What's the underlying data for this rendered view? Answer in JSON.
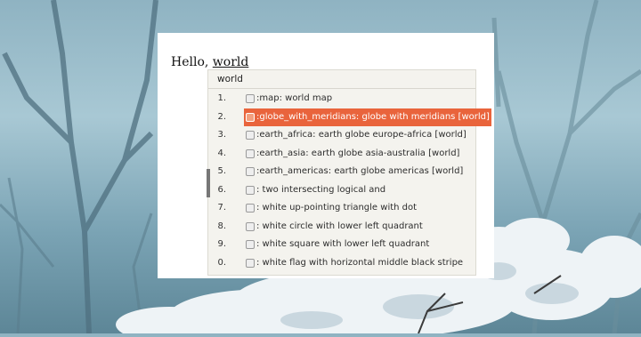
{
  "editor": {
    "greeting": "Hello,",
    "word": "world"
  },
  "popup": {
    "query": "world",
    "items": [
      {
        "num": "1.",
        "icon": "map-icon",
        "label": ":map: world map",
        "selected": false
      },
      {
        "num": "2.",
        "icon": "globe-with-meridians-icon",
        "label": ":globe_with_meridians: globe with meridians [world]",
        "selected": true
      },
      {
        "num": "3.",
        "icon": "earth-africa-icon",
        "label": ":earth_africa: earth globe europe-africa [world]",
        "selected": false
      },
      {
        "num": "4.",
        "icon": "earth-asia-icon",
        "label": ":earth_asia: earth globe asia-australia [world]",
        "selected": false
      },
      {
        "num": "5.",
        "icon": "earth-americas-icon",
        "label": ":earth_americas: earth globe americas [world]",
        "selected": false
      },
      {
        "num": "6.",
        "icon": "logical-and-icon",
        "label": ": two intersecting logical and",
        "selected": false
      },
      {
        "num": "7.",
        "icon": "triangle-dot-icon",
        "label": ": white up-pointing triangle with dot",
        "selected": false
      },
      {
        "num": "8.",
        "icon": "circle-quadrant-icon",
        "label": ": white circle with lower left quadrant",
        "selected": false
      },
      {
        "num": "9.",
        "icon": "square-quadrant-icon",
        "label": ": white square with lower left quadrant",
        "selected": false
      },
      {
        "num": "0.",
        "icon": "flag-stripe-icon",
        "label": ": white flag with horizontal middle black stripe",
        "selected": false
      }
    ]
  },
  "colors": {
    "selection": "#e9643c",
    "popup_bg": "#f4f3ee"
  }
}
